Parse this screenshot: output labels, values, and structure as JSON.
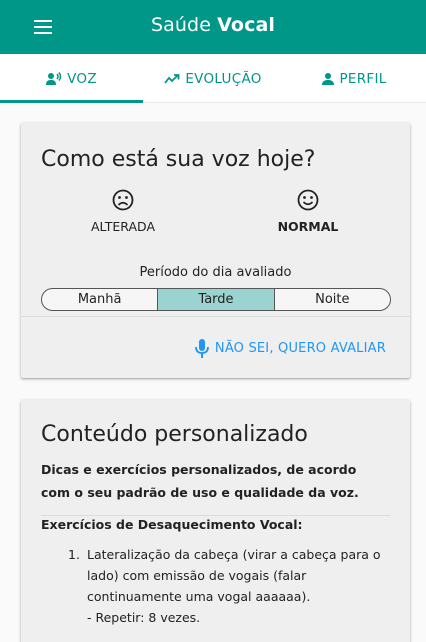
{
  "appbar": {
    "title_regular": "Saúde ",
    "title_bold": "Vocal",
    "menu_icon": "menu-icon",
    "bg_color": "#009688"
  },
  "tabs": [
    {
      "label": "VOZ",
      "icon": "voice-icon",
      "selected": true
    },
    {
      "label": "EVOLUÇÃO",
      "icon": "trending-icon",
      "selected": false
    },
    {
      "label": "PERFIL",
      "icon": "person-icon",
      "selected": false
    }
  ],
  "voice_card": {
    "title": "Como está sua voz hoje?",
    "moods": [
      {
        "label": "ALTERADA",
        "icon": "sad-face-icon",
        "selected": false
      },
      {
        "label": "NORMAL",
        "icon": "happy-face-icon",
        "selected": true
      }
    ],
    "period_label": "Período do dia avaliado",
    "periods": [
      "Manhã",
      "Tarde",
      "Noite"
    ],
    "selected_period": "Tarde",
    "evaluate_button": "NÃO SEI, QUERO AVALIAR",
    "evaluate_icon": "microphone-icon",
    "accent_color": "#2196f3"
  },
  "content_card": {
    "title": "Conteúdo personalizado",
    "intro": "Dicas e exercícios personalizados, de acordo com o seu padrão de uso e qualidade da voz.",
    "section_title": "Exercícios de Desaquecimento Vocal:",
    "exercises": [
      {
        "number": "1.",
        "text": "Lateralização da cabeça (virar a cabeça para o lado) com emissão de vogais (falar continuamente uma vogal aaaaaa).",
        "repeat": "- Repetir: 8 vezes."
      }
    ]
  }
}
